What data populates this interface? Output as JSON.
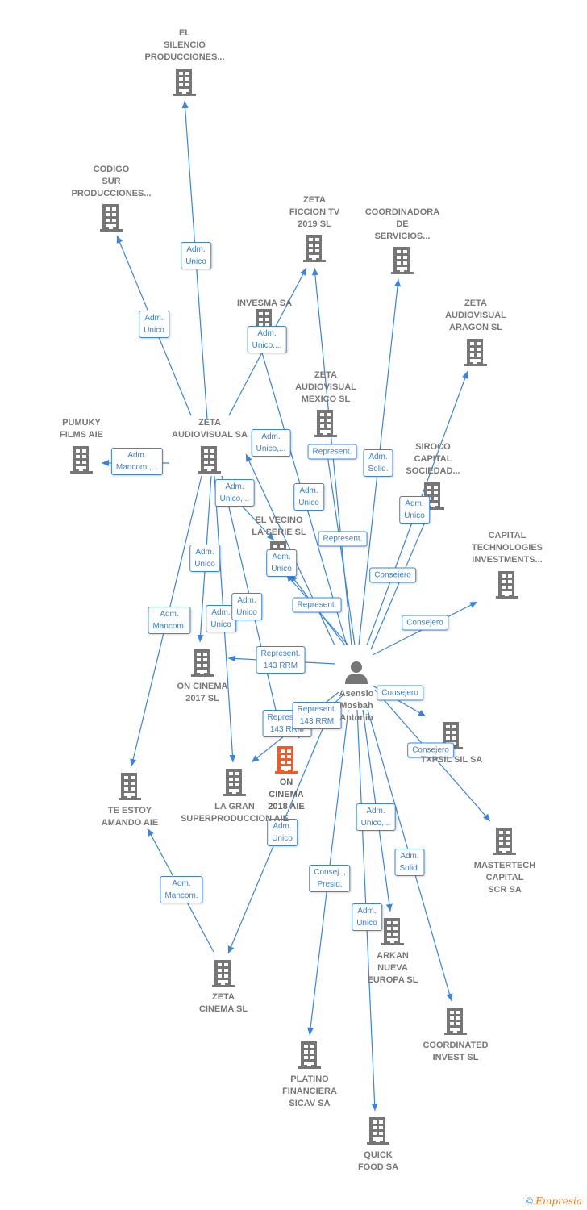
{
  "colors": {
    "edge": "#3a84e0",
    "company": "#767676",
    "focus_company": "#f05a28",
    "person": "#767676"
  },
  "person": {
    "id": "p",
    "label": [
      "Asensio",
      "Mosbah",
      "Antonio"
    ]
  },
  "nodes": [
    {
      "id": "silencio",
      "label": [
        "EL",
        "SILENCIO",
        "PRODUCCIONES..."
      ]
    },
    {
      "id": "codigo",
      "label": [
        "CODIGO",
        "SUR",
        "PRODUCCIONES..."
      ]
    },
    {
      "id": "ficcion",
      "label": [
        "ZETA",
        "FICCION TV",
        "2019  SL"
      ]
    },
    {
      "id": "coord",
      "label": [
        "COORDINADORA",
        "DE",
        "SERVICIOS..."
      ]
    },
    {
      "id": "invesma",
      "label": [
        "INVESMA SA"
      ]
    },
    {
      "id": "aragon",
      "label": [
        "ZETA",
        "AUDIOVISUAL",
        "ARAGON SL"
      ]
    },
    {
      "id": "mexico",
      "label": [
        "ZETA",
        "AUDIOVISUAL",
        "MEXICO  SL"
      ]
    },
    {
      "id": "pumuky",
      "label": [
        "PUMUKY",
        "FILMS AIE"
      ]
    },
    {
      "id": "zetaav",
      "label": [
        "ZETA",
        "AUDIOVISUAL SA"
      ]
    },
    {
      "id": "siroco",
      "label": [
        "SIROCO",
        "CAPITAL",
        "SOCIEDAD..."
      ]
    },
    {
      "id": "vecino",
      "label": [
        "EL VECINO",
        "LA SERIE  SL"
      ]
    },
    {
      "id": "captech",
      "label": [
        "CAPITAL",
        "TECHNOLOGIES",
        "INVESTMENTS..."
      ]
    },
    {
      "id": "oncinema17",
      "label": [
        "ON CINEMA",
        "2017  SL"
      ]
    },
    {
      "id": "txpsil",
      "label": [
        "TXPSIL SIL SA"
      ]
    },
    {
      "id": "oncinema18",
      "label": [
        "ON",
        "CINEMA",
        "2018  AIE"
      ],
      "focus": true
    },
    {
      "id": "teestoy",
      "label": [
        "TE ESTOY",
        "AMANDO AIE"
      ]
    },
    {
      "id": "lagran",
      "label": [
        "LA GRAN",
        "SUPERPRODUCCION AIE"
      ]
    },
    {
      "id": "mastertech",
      "label": [
        "MASTERTECH",
        "CAPITAL",
        "SCR SA"
      ]
    },
    {
      "id": "arkan",
      "label": [
        "ARKAN",
        "NUEVA",
        "EUROPA  SL"
      ]
    },
    {
      "id": "zetacinema",
      "label": [
        "ZETA",
        "CINEMA SL"
      ]
    },
    {
      "id": "coordinated",
      "label": [
        "COORDINATED",
        "INVEST  SL"
      ]
    },
    {
      "id": "platino",
      "label": [
        "PLATINO",
        "FINANCIERA",
        "SICAV SA"
      ]
    },
    {
      "id": "quick",
      "label": [
        "QUICK",
        "FOOD SA"
      ]
    }
  ],
  "edges": [
    {
      "from": "zetaav",
      "to": "silencio",
      "label": [
        "Adm.",
        "Unico"
      ]
    },
    {
      "from": "zetaav",
      "to": "codigo",
      "label": [
        "Adm.",
        "Unico"
      ]
    },
    {
      "from": "zetaav",
      "to": "ficcion",
      "label": [
        "Adm.",
        "Unico,..."
      ]
    },
    {
      "from": "zetaav",
      "to": "pumuky",
      "label": [
        "Adm.",
        "Mancom.,..."
      ]
    },
    {
      "from": "p",
      "to": "zetaav",
      "label": [
        "Adm.",
        "Unico,..."
      ]
    },
    {
      "from": "p",
      "to": "invesma",
      "label": [
        "Adm.",
        "Unico"
      ]
    },
    {
      "from": "p",
      "to": "ficcion",
      "label": [
        "Represent."
      ]
    },
    {
      "from": "p",
      "to": "coord",
      "label": [
        "Adm.",
        "Solid."
      ]
    },
    {
      "from": "p",
      "to": "mexico",
      "label": [
        "Represent."
      ]
    },
    {
      "from": "p",
      "to": "aragon",
      "label": [
        "Adm.",
        "Unico"
      ]
    },
    {
      "from": "p",
      "to": "siroco",
      "label": [
        "Consejero"
      ]
    },
    {
      "from": "p",
      "to": "captech",
      "label": [
        "Consejero"
      ]
    },
    {
      "from": "p",
      "to": "vecino",
      "label": [
        "Represent."
      ]
    },
    {
      "from": "zetaav",
      "to": "vecino",
      "label": [
        "Adm.",
        "Unico,..."
      ]
    },
    {
      "from": "p",
      "to": "vecino",
      "label": [
        "Adm.",
        "Unico"
      ]
    },
    {
      "from": "p",
      "to": "oncinema17",
      "label": [
        "Represent.",
        "143 RRM"
      ]
    },
    {
      "from": "zetaav",
      "to": "oncinema17",
      "label": [
        "Adm.",
        "Unico"
      ]
    },
    {
      "from": "zetaav",
      "to": "teestoy",
      "label": [
        "Adm.",
        "Mancom."
      ]
    },
    {
      "from": "zetaav",
      "to": "lagran",
      "label": [
        "Adm.",
        "Unico"
      ]
    },
    {
      "from": "zetaav",
      "to": "oncinema18",
      "label": [
        "Adm.",
        "Unico"
      ]
    },
    {
      "from": "p",
      "to": "lagran",
      "label": [
        "Represent.",
        "143 RRM"
      ]
    },
    {
      "from": "p",
      "to": "oncinema18",
      "label": [
        "Represent.",
        "143 RRM"
      ]
    },
    {
      "from": "p",
      "to": "txpsil",
      "label": [
        "Consejero"
      ]
    },
    {
      "from": "p",
      "to": "mastertech",
      "label": [
        "Consejero"
      ]
    },
    {
      "from": "p",
      "to": "zetacinema",
      "label": [
        "Adm.",
        "Unico"
      ]
    },
    {
      "from": "zetacinema",
      "to": "teestoy",
      "label": [
        "Adm.",
        "Mancom."
      ]
    },
    {
      "from": "p",
      "to": "platino",
      "label": [
        "Consej. ,",
        "Presid."
      ]
    },
    {
      "from": "p",
      "to": "arkan",
      "label": [
        "Adm.",
        "Unico,..."
      ]
    },
    {
      "from": "p",
      "to": "quick",
      "label": [
        "Adm.",
        "Unico"
      ]
    },
    {
      "from": "p",
      "to": "coordinated",
      "label": [
        "Adm.",
        "Solid."
      ]
    }
  ],
  "footer": {
    "copyright": "©",
    "brand": "Empresia"
  }
}
